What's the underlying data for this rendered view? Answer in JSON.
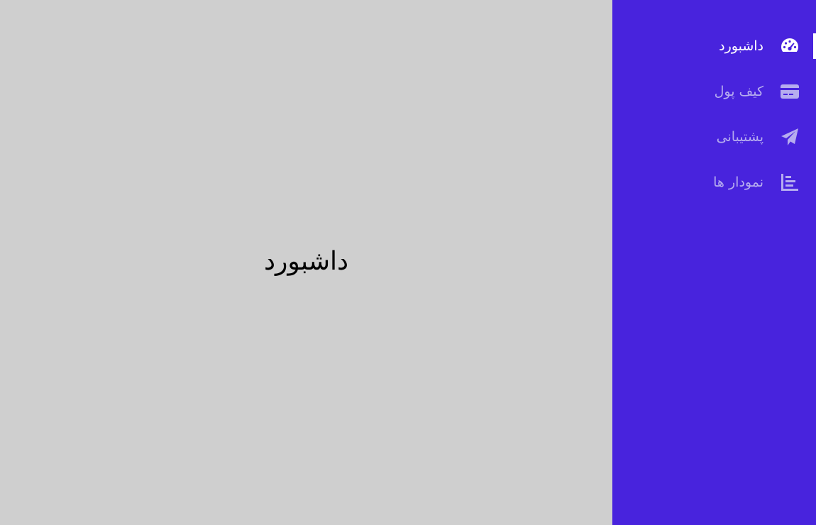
{
  "main": {
    "title": "داشبورد"
  },
  "sidebar": {
    "items": [
      {
        "label": "داشبورد",
        "icon": "gauge-icon",
        "active": true
      },
      {
        "label": "کیف پول",
        "icon": "credit-card-icon",
        "active": false
      },
      {
        "label": "پشتیبانی",
        "icon": "paper-plane-icon",
        "active": false
      },
      {
        "label": "نمودار ها",
        "icon": "bar-chart-icon",
        "active": false
      }
    ]
  },
  "colors": {
    "sidebar_bg": "#4823dd",
    "main_bg": "#cfcfcf",
    "active_text": "#ffffff",
    "inactive_text": "#b6acef"
  }
}
